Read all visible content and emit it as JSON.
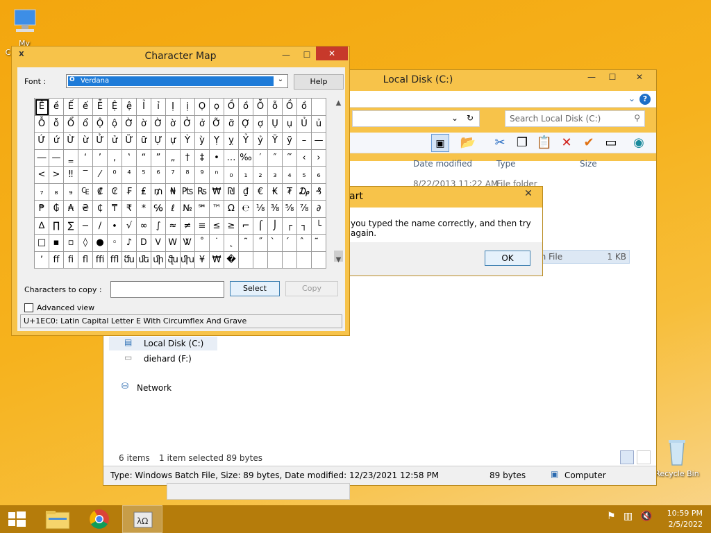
{
  "desktop": {
    "icons": [
      {
        "label": "My Computer"
      },
      {
        "label": "Recycle Bin"
      }
    ]
  },
  "explorer": {
    "title": "Local Disk (C:)",
    "search_placeholder": "Search Local Disk (C:)",
    "columns": [
      "Date modified",
      "Type",
      "Size"
    ],
    "row1": {
      "date": "8/22/2013 11:22 AM",
      "type": "File folder"
    },
    "row_selected": {
      "type_tail": "ch File",
      "size": "1 KB"
    },
    "nav": [
      {
        "label": "Local Disk (C:)"
      },
      {
        "label": "diehard (F:)"
      },
      {
        "label": "Network"
      }
    ],
    "status": {
      "items": "6 items",
      "selected": "1 item selected  89 bytes"
    },
    "details": {
      "text": "Type: Windows Batch File, Size: 89 bytes, Date modified: 12/23/2021 12:58 PM",
      "size": "89 bytes",
      "location": "Computer"
    }
  },
  "dialog": {
    "title": "art",
    "message": "you typed the name correctly, and then try again.",
    "ok_label": "OK"
  },
  "charmap": {
    "title": "Character Map",
    "font_label": "Font :",
    "font_value": "Verdana",
    "help_label": "Help",
    "copy_label": "Characters to copy :",
    "copy_value": "",
    "select_label": "Select",
    "copy_button_label": "Copy",
    "advanced_label": "Advanced view",
    "status": "U+1EC0: Latin Capital Letter E With Circumflex And Grave",
    "selected_index": 0,
    "chars": [
      "Ề",
      "ề",
      "Ế",
      "ế",
      "Ễ",
      "Ệ",
      "ệ",
      "Ỉ",
      "ỉ",
      "Ị",
      "ị",
      "Ọ",
      "ọ",
      "Ồ",
      "ồ",
      "Ỗ",
      "ỗ",
      "Ồ",
      "ồ",
      "",
      "Ỗ",
      "ỗ",
      "Ổ",
      "ổ",
      "Ộ",
      "ộ",
      "Ờ",
      "ờ",
      "Ờ",
      "ờ",
      "Ở",
      "ở",
      "Ỡ",
      "ỡ",
      "Ợ",
      "ợ",
      "Ụ",
      "ụ",
      "Ủ",
      "ủ",
      "Ứ",
      "ứ",
      "Ừ",
      "ừ",
      "Ử",
      "ử",
      "Ữ",
      "ữ",
      "Ự",
      "ự",
      "Ỳ",
      "ỳ",
      "Ỵ",
      "ỵ",
      "Ỷ",
      "ỷ",
      "Ỹ",
      "ỹ",
      "–",
      "—",
      "―",
      "—",
      "‗",
      "‘",
      "’",
      "‚",
      "‛",
      "“",
      "”",
      "„",
      "†",
      "‡",
      "•",
      "…",
      "‰",
      "′",
      "″",
      "‴",
      "‹",
      "›",
      "<",
      ">",
      "‼",
      "‾",
      "⁄",
      "⁰",
      "⁴",
      "⁵",
      "⁶",
      "⁷",
      "⁸",
      "⁹",
      "ⁿ",
      "₀",
      "₁",
      "₂",
      "₃",
      "₄",
      "₅",
      "₆",
      "₇",
      "₈",
      "₉",
      "₠",
      "₡",
      "₢",
      "₣",
      "₤",
      "₥",
      "₦",
      "₧",
      "₨",
      "₩",
      "₪",
      "₫",
      "€",
      "₭",
      "₮",
      "₯",
      "₰",
      "₱",
      "₲",
      "₳",
      "₴",
      "₵",
      "₸",
      "₹",
      "*",
      "℅",
      "ℓ",
      "№",
      "℠",
      "™",
      "Ω",
      "℮",
      "⅛",
      "⅜",
      "⅝",
      "⅞",
      "∂",
      "∆",
      "∏",
      "∑",
      "−",
      "∕",
      "∙",
      "√",
      "∞",
      "∫",
      "≈",
      "≠",
      "≡",
      "≤",
      "≥",
      "⌐",
      "⌠",
      "⌡",
      "┌",
      "┐",
      "└",
      "□",
      "▪",
      "▫",
      "◊",
      "●",
      "◦",
      "♪",
      "Ꭰ",
      "Ꮩ",
      "Ꮃ",
      "Ꮤ",
      "˚",
      "˙",
      "˛",
      "˜",
      "˝",
      "̀",
      "́",
      "̂",
      "̃",
      "ʼ",
      "ﬀ",
      "ﬁ",
      "ﬂ",
      "ﬃ",
      "ﬄ",
      "ﬓ",
      "ﬔ",
      "ﬕ",
      "ﬖ",
      "ﬗ",
      "¥",
      "₩",
      "�",
      "",
      "",
      "",
      "",
      "",
      ""
    ]
  },
  "taskbar": {
    "time": "10:59 PM",
    "date": "2/5/2022"
  },
  "colors": {
    "accent_frame": "#f7c34a",
    "taskbar": "#b57c0b",
    "selection": "#1e7bd8"
  }
}
